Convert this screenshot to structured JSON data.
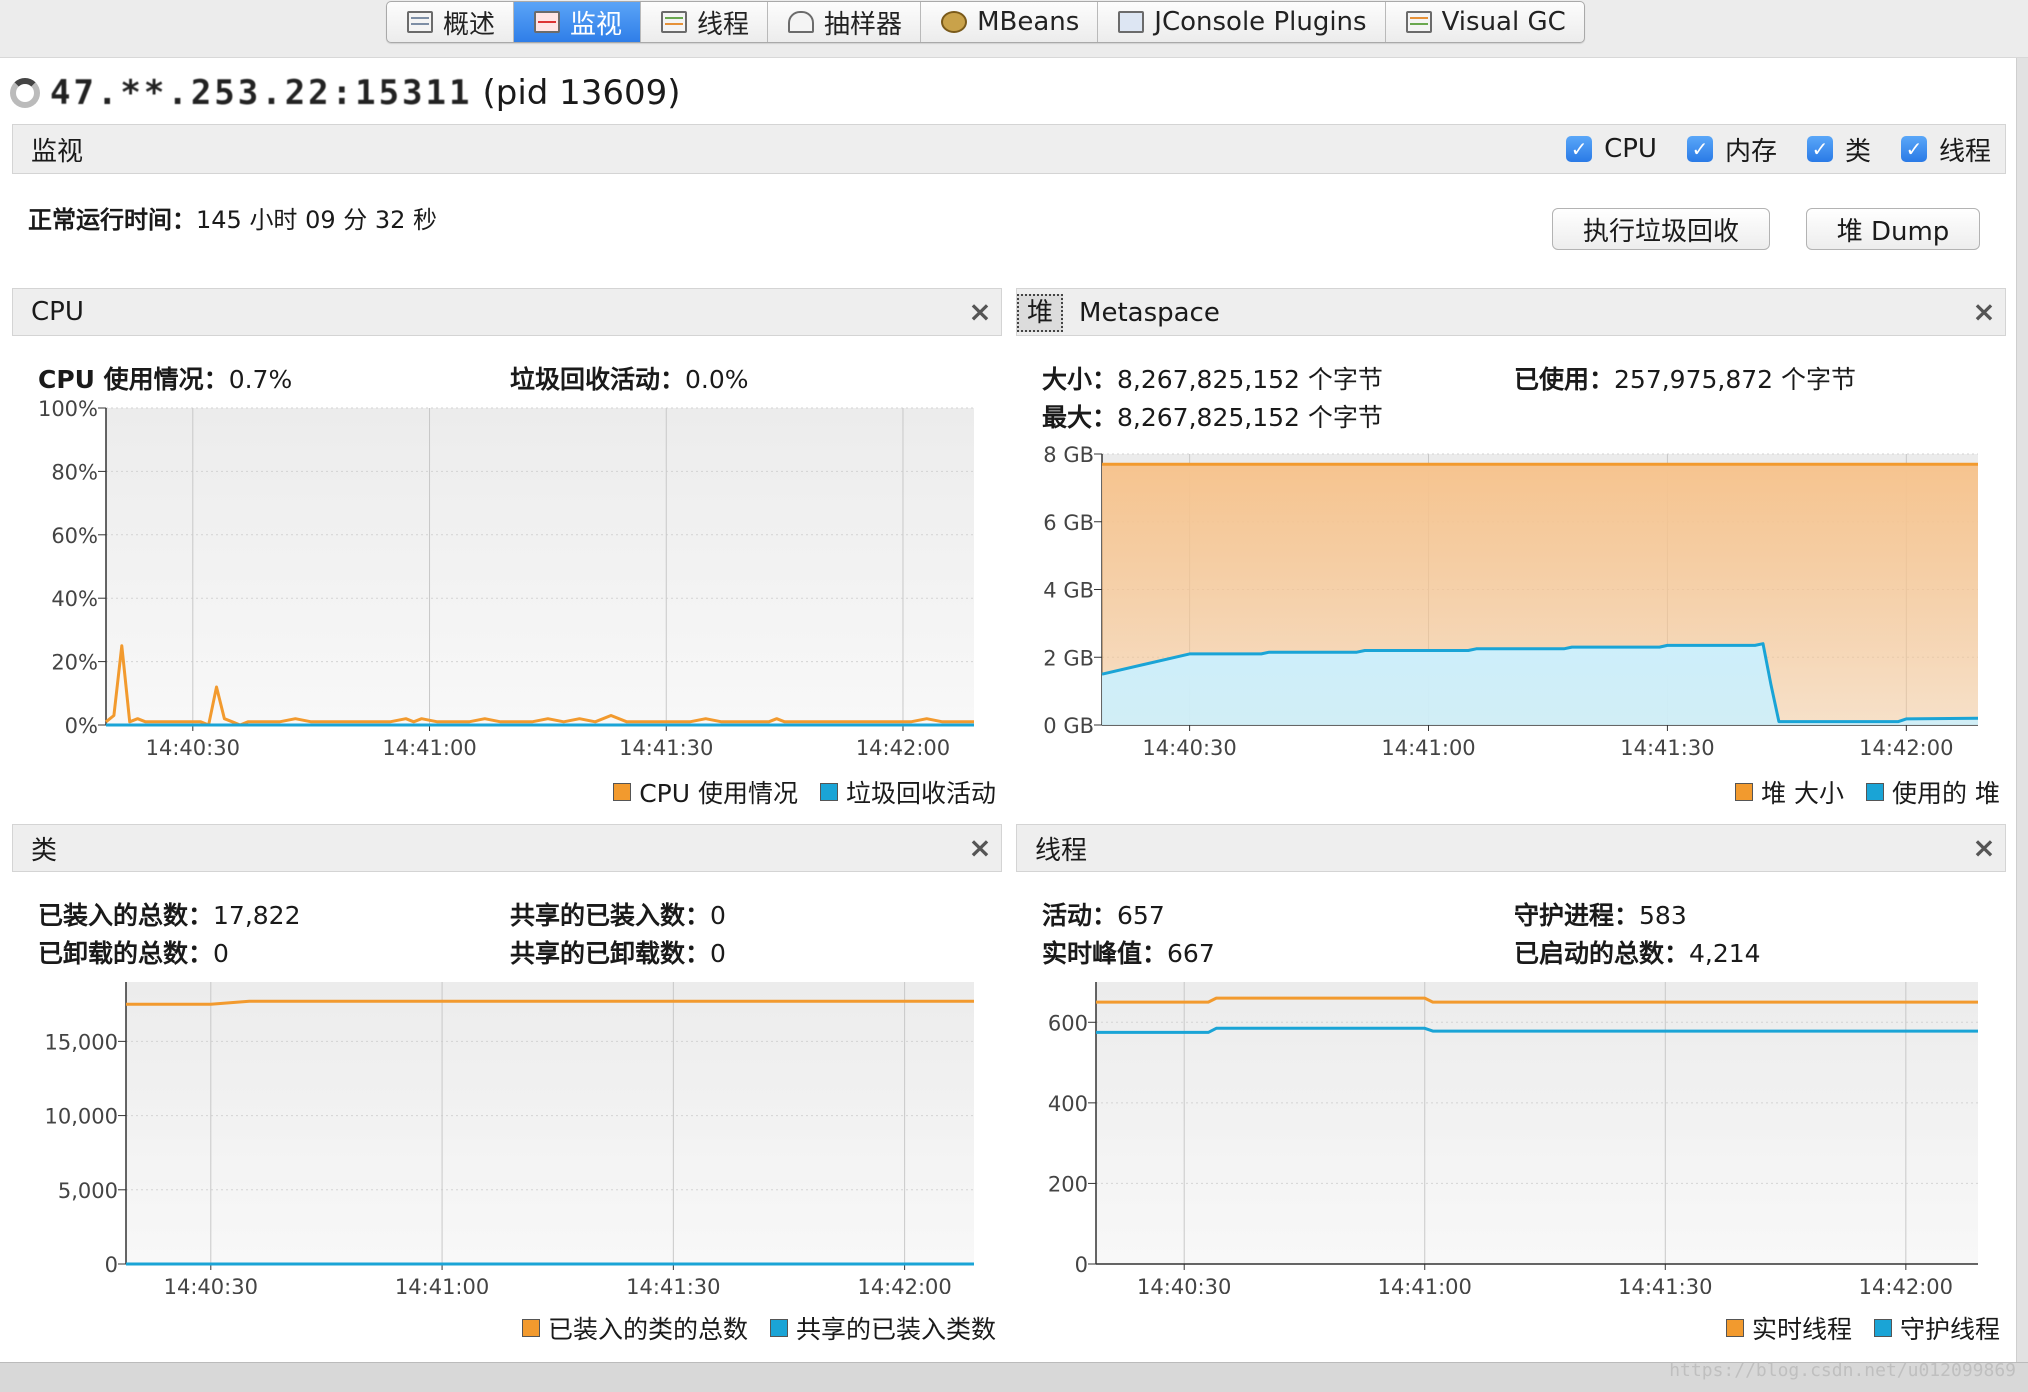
{
  "tabs": [
    {
      "label": "概述",
      "icon": "overview-icon"
    },
    {
      "label": "监视",
      "icon": "monitor-icon",
      "active": true
    },
    {
      "label": "线程",
      "icon": "threads-icon"
    },
    {
      "label": "抽样器",
      "icon": "sampler-icon"
    },
    {
      "label": "MBeans",
      "icon": "mbeans-icon"
    },
    {
      "label": "JConsole Plugins",
      "icon": "jconsole-icon"
    },
    {
      "label": "Visual GC",
      "icon": "visualgc-icon"
    }
  ],
  "title": {
    "host": "47.**.253.22:15311",
    "pid": "(pid 13609)"
  },
  "monitor": {
    "heading": "监视",
    "checks": [
      {
        "label": "CPU",
        "checked": true
      },
      {
        "label": "内存",
        "checked": true
      },
      {
        "label": "类",
        "checked": true
      },
      {
        "label": "线程",
        "checked": true
      }
    ],
    "uptime_label": "正常运行时间：",
    "uptime_value": "145 小时 09 分 32 秒",
    "gc_button": "执行垃圾回收",
    "dump_button": "堆 Dump"
  },
  "colors": {
    "orange": "#f29a2e",
    "blue": "#1aa4d6",
    "orange_fill": "#f6c48f",
    "blue_fill": "#cdeffb"
  },
  "cpu_panel": {
    "title": "CPU",
    "usage_label": "CPU 使用情况：",
    "usage_value": "0.7%",
    "gc_label": "垃圾回收活动：",
    "gc_value": "0.0%",
    "legend": [
      "CPU 使用情况",
      "垃圾回收活动"
    ]
  },
  "heap_panel": {
    "tab_heap": "堆",
    "tab_meta": "Metaspace",
    "size_label": "大小：",
    "size_value": "8,267,825,152 个字节",
    "used_label": "已使用：",
    "used_value": "257,975,872 个字节",
    "max_label": "最大：",
    "max_value": "8,267,825,152 个字节",
    "legend": [
      "堆 大小",
      "使用的 堆"
    ]
  },
  "classes_panel": {
    "title": "类",
    "loaded_label": "已装入的总数：",
    "loaded_value": "17,822",
    "shared_loaded_label": "共享的已装入数：",
    "shared_loaded_value": "0",
    "unloaded_label": "已卸载的总数：",
    "unloaded_value": "0",
    "shared_unloaded_label": "共享的已卸载数：",
    "shared_unloaded_value": "0",
    "legend": [
      "已装入的类的总数",
      "共享的已装入类数"
    ]
  },
  "threads_panel": {
    "title": "线程",
    "live_label": "活动：",
    "live_value": "657",
    "daemon_label": "守护进程：",
    "daemon_value": "583",
    "peak_label": "实时峰值：",
    "peak_value": "667",
    "started_label": "已启动的总数：",
    "started_value": "4,214",
    "legend": [
      "实时线程",
      "守护线程"
    ]
  },
  "watermark": "https://blog.csdn.net/u012099869",
  "chart_data": [
    {
      "id": "cpu",
      "type": "line",
      "x_ticks": [
        "14:40:30",
        "14:41:00",
        "14:41:30",
        "14:42:00"
      ],
      "y_ticks": [
        "0%",
        "20%",
        "40%",
        "60%",
        "80%",
        "100%"
      ],
      "ylim": [
        0,
        100
      ],
      "grid": true,
      "legend_position": "bottom-right",
      "x_range": [
        0,
        110
      ],
      "x_tick_values": [
        11,
        41,
        71,
        101
      ],
      "series": [
        {
          "name": "CPU 使用情况",
          "color": "orange",
          "x": [
            0,
            1,
            2,
            3,
            4,
            5,
            6,
            8,
            10,
            12,
            13,
            14,
            15,
            16,
            17,
            18,
            20,
            22,
            24,
            26,
            28,
            30,
            32,
            34,
            36,
            38,
            39,
            40,
            42,
            44,
            46,
            48,
            50,
            52,
            54,
            56,
            58,
            60,
            62,
            64,
            66,
            68,
            70,
            72,
            74,
            76,
            78,
            80,
            82,
            84,
            85,
            86,
            88,
            90,
            92,
            94,
            96,
            98,
            100,
            102,
            104,
            106,
            108,
            110
          ],
          "y": [
            1,
            3,
            25,
            1,
            2,
            1,
            1,
            1,
            1,
            1,
            0,
            12,
            2,
            1,
            0,
            1,
            1,
            1,
            2,
            1,
            1,
            1,
            1,
            1,
            1,
            2,
            1,
            2,
            1,
            1,
            1,
            2,
            1,
            1,
            1,
            2,
            1,
            2,
            1,
            3,
            1,
            1,
            1,
            1,
            1,
            2,
            1,
            1,
            1,
            1,
            2,
            1,
            1,
            1,
            1,
            1,
            1,
            1,
            1,
            1,
            2,
            1,
            1,
            1
          ]
        },
        {
          "name": "垃圾回收活动",
          "color": "blue",
          "x": [
            0,
            110
          ],
          "y": [
            0,
            0
          ]
        }
      ]
    },
    {
      "id": "heap",
      "type": "area",
      "x_ticks": [
        "14:40:30",
        "14:41:00",
        "14:41:30",
        "14:42:00"
      ],
      "y_ticks": [
        "0 GB",
        "2 GB",
        "4 GB",
        "6 GB",
        "8 GB"
      ],
      "ylim": [
        0,
        8
      ],
      "grid": true,
      "legend_position": "bottom-right",
      "x_range": [
        0,
        110
      ],
      "x_tick_values": [
        11,
        41,
        71,
        101
      ],
      "series": [
        {
          "name": "堆 大小",
          "color": "orange",
          "x": [
            0,
            110
          ],
          "y": [
            7.7,
            7.7
          ]
        },
        {
          "name": "使用的 堆",
          "color": "blue",
          "x": [
            0,
            11,
            20,
            21,
            32,
            33,
            46,
            47,
            58,
            59,
            70,
            71,
            82,
            83,
            84,
            85,
            100,
            101,
            110
          ],
          "y": [
            1.5,
            2.1,
            2.1,
            2.15,
            2.15,
            2.2,
            2.2,
            2.25,
            2.25,
            2.3,
            2.3,
            2.35,
            2.35,
            2.4,
            1.2,
            0.1,
            0.1,
            0.18,
            0.2
          ]
        }
      ]
    },
    {
      "id": "classes",
      "type": "line",
      "x_ticks": [
        "14:40:30",
        "14:41:00",
        "14:41:30",
        "14:42:00"
      ],
      "y_ticks": [
        "0",
        "5,000",
        "10,000",
        "15,000"
      ],
      "ylim": [
        0,
        19000
      ],
      "grid": true,
      "legend_position": "bottom-right",
      "x_range": [
        0,
        110
      ],
      "x_tick_values": [
        11,
        41,
        71,
        101
      ],
      "series": [
        {
          "name": "已装入的类的总数",
          "color": "orange",
          "x": [
            0,
            11,
            16,
            110
          ],
          "y": [
            17500,
            17500,
            17700,
            17700
          ]
        },
        {
          "name": "共享的已装入类数",
          "color": "blue",
          "x": [
            0,
            110
          ],
          "y": [
            0,
            0
          ]
        }
      ]
    },
    {
      "id": "threads",
      "type": "line",
      "x_ticks": [
        "14:40:30",
        "14:41:00",
        "14:41:30",
        "14:42:00"
      ],
      "y_ticks": [
        "0",
        "200",
        "400",
        "600"
      ],
      "ylim": [
        0,
        700
      ],
      "grid": true,
      "legend_position": "bottom-right",
      "x_range": [
        0,
        110
      ],
      "x_tick_values": [
        11,
        41,
        71,
        101
      ],
      "series": [
        {
          "name": "实时线程",
          "color": "orange",
          "x": [
            0,
            14,
            15,
            41,
            42,
            110
          ],
          "y": [
            650,
            650,
            660,
            660,
            650,
            650
          ]
        },
        {
          "name": "守护线程",
          "color": "blue",
          "x": [
            0,
            14,
            15,
            41,
            42,
            110
          ],
          "y": [
            575,
            575,
            585,
            585,
            578,
            578
          ]
        }
      ]
    }
  ]
}
